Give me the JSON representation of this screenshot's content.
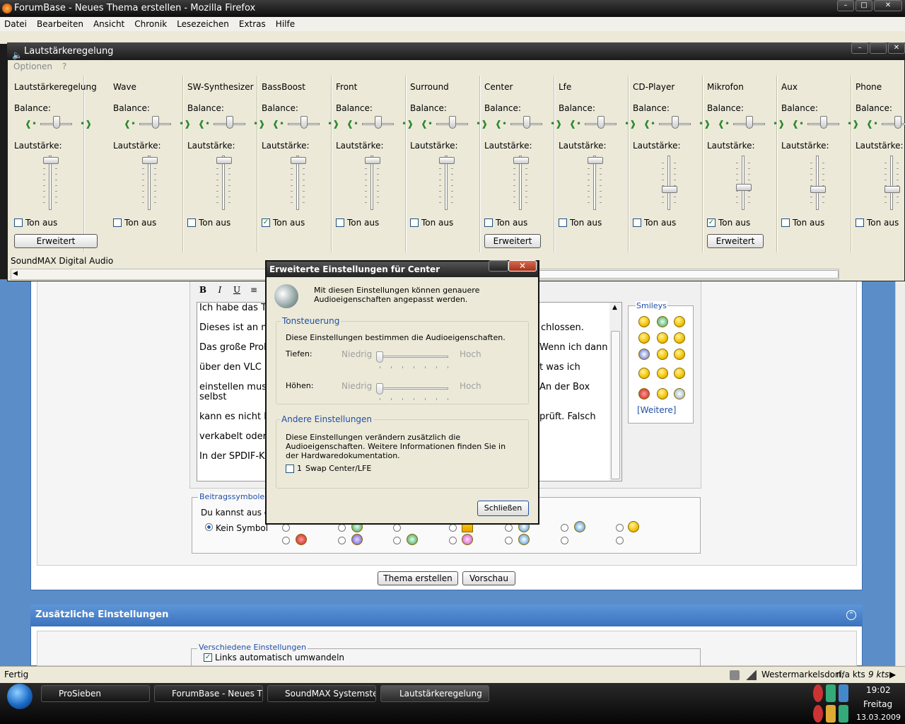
{
  "firefox": {
    "title": "ForumBase - Neues Thema erstellen - Mozilla Firefox",
    "menu": [
      "Datei",
      "Bearbeiten",
      "Ansicht",
      "Chronik",
      "Lesezeichen",
      "Extras",
      "Hilfe"
    ],
    "status": "Fertig"
  },
  "editor": {
    "toolbar": [
      "B",
      "I",
      "U"
    ],
    "lines_left": [
      "Ich habe das T",
      "Dieses ist an m",
      "Das große Prob",
      "über den VLC M",
      "einstellen muss",
      "selbst",
      "kann es nicht li",
      "verkabelt oder",
      "In der SPDIF-K"
    ],
    "lines_right": [
      "chlossen.",
      "Wenn ich dann",
      "t was ich",
      "An der Box",
      "prüft. Falsch"
    ],
    "smileys_label": "Smileys",
    "smileys_more": "[Weitere]"
  },
  "symbols": {
    "legend": "Beitragssymbole",
    "hint": "Du kannst aus d",
    "none": "Kein Symbol"
  },
  "buttons": {
    "create": "Thema erstellen",
    "preview": "Vorschau"
  },
  "extra": {
    "header": "Zusätzliche Einstellungen",
    "group": "Verschiedene Einstellungen",
    "links": "Links automatisch umwandeln"
  },
  "statusbar": {
    "weather": "Westermarkelsdorf:",
    "value": "n/a kts",
    "speed": "9 kts"
  },
  "taskbar": {
    "items": [
      "ProSieben",
      "ForumBase - Neues Th...",
      "SoundMAX Systemste...",
      "Lautstärkeregelung"
    ],
    "time": "19:02",
    "day": "Freitag",
    "date": "13.03.2009"
  },
  "mixer": {
    "title": "Lautstärkeregelung",
    "options": "Optionen",
    "help": "?",
    "balance_label": "Balance:",
    "volume_label": "Lautstärke:",
    "mute_label": "Ton aus",
    "advanced_label": "Erweitert",
    "footer": "SoundMAX Digital Audio",
    "channels": [
      {
        "name": "Lautstärkeregelung",
        "muted": false,
        "advanced": true,
        "balance": 0.5,
        "volume": 1.0
      },
      {
        "name": "Wave",
        "muted": false,
        "advanced": false,
        "balance": 0.5,
        "volume": 1.0
      },
      {
        "name": "SW-Synthesizer",
        "muted": false,
        "advanced": false,
        "balance": 0.5,
        "volume": 1.0
      },
      {
        "name": "BassBoost",
        "muted": true,
        "advanced": false,
        "balance": 0.5,
        "volume": 1.0
      },
      {
        "name": "Front",
        "muted": false,
        "advanced": false,
        "balance": 0.5,
        "volume": 1.0
      },
      {
        "name": "Surround",
        "muted": false,
        "advanced": false,
        "balance": 0.5,
        "volume": 1.0
      },
      {
        "name": "Center",
        "muted": false,
        "advanced": true,
        "balance": 0.5,
        "volume": 1.0
      },
      {
        "name": "Lfe",
        "muted": false,
        "advanced": false,
        "balance": 0.5,
        "volume": 1.0
      },
      {
        "name": "CD-Player",
        "muted": false,
        "advanced": false,
        "balance": 0.5,
        "volume": 0.3
      },
      {
        "name": "Mikrofon",
        "muted": true,
        "advanced": true,
        "balance": 0.5,
        "volume": 0.35
      },
      {
        "name": "Aux",
        "muted": false,
        "advanced": false,
        "balance": 0.5,
        "volume": 0.3
      },
      {
        "name": "Phone",
        "muted": false,
        "advanced": false,
        "balance": 0.5,
        "volume": 0.3
      }
    ]
  },
  "dialog": {
    "title": "Erweiterte Einstellungen für Center",
    "intro": "Mit diesen Einstellungen können genauere Audioeigenschaften angepasst werden.",
    "tone_group": "Tonsteuerung",
    "tone_text": "Diese Einstellungen bestimmen die Audioeigenschaften.",
    "bass_label": "Tiefen:",
    "treble_label": "Höhen:",
    "low": "Niedrig",
    "high": "Hoch",
    "other_group": "Andere Einstellungen",
    "other_text": "Diese Einstellungen verändern zusätzlich die Audioeigenschaften. Weitere Informationen finden Sie in der Hardwaredokumentation.",
    "swap_num": "1",
    "swap_label": "Swap Center/LFE",
    "close": "Schließen"
  }
}
